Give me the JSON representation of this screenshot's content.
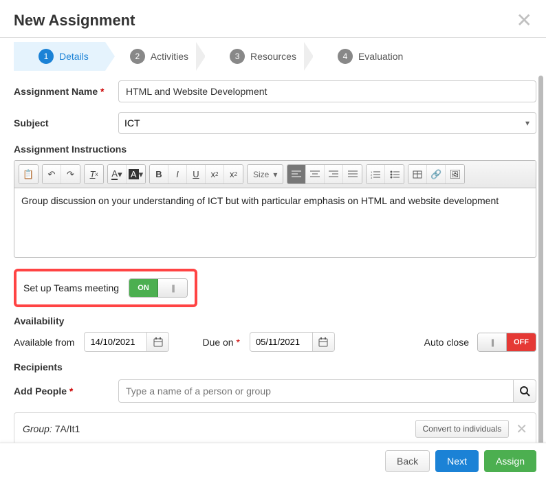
{
  "header": {
    "title": "New Assignment"
  },
  "wizard": {
    "steps": [
      {
        "num": "1",
        "label": "Details"
      },
      {
        "num": "2",
        "label": "Activities"
      },
      {
        "num": "3",
        "label": "Resources"
      },
      {
        "num": "4",
        "label": "Evaluation"
      }
    ]
  },
  "form": {
    "assignment_name_label": "Assignment Name",
    "assignment_name_value": "HTML and Website Development",
    "subject_label": "Subject",
    "subject_value": "ICT",
    "instructions_label": "Assignment Instructions",
    "instructions_value": "Group discussion on your understanding of ICT but with particular emphasis on HTML and website development",
    "toolbar_size_label": "Size",
    "teams_label": "Set up Teams meeting",
    "teams_on": "ON",
    "availability_label": "Availability",
    "available_from_label": "Available from",
    "available_from_value": "14/10/2021",
    "due_on_label": "Due on",
    "due_on_value": "05/11/2021",
    "auto_close_label": "Auto close",
    "auto_close_off": "OFF",
    "recipients_label": "Recipients",
    "add_people_label": "Add People",
    "add_people_placeholder": "Type a name of a person or group",
    "group_prefix": "Group:",
    "group_name": "7A/It1",
    "convert_label": "Convert to individuals"
  },
  "footer": {
    "back": "Back",
    "next": "Next",
    "assign": "Assign"
  }
}
